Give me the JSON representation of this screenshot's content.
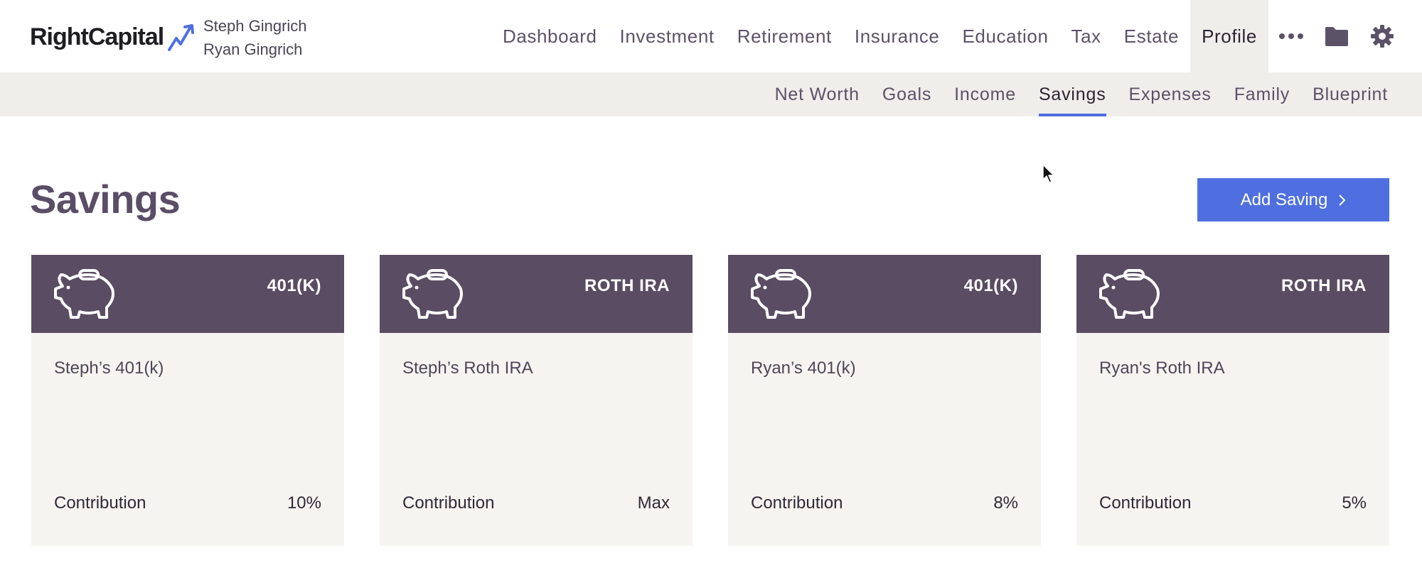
{
  "brand": {
    "name": "RightCapital",
    "accent": "#4f6fe0"
  },
  "clients": [
    "Steph Gingrich",
    "Ryan Gingrich"
  ],
  "main_nav": {
    "items": [
      "Dashboard",
      "Investment",
      "Retirement",
      "Insurance",
      "Education",
      "Tax",
      "Estate",
      "Profile"
    ],
    "active": "Profile",
    "icons": [
      "more-icon",
      "folder-icon",
      "gear-icon"
    ]
  },
  "sub_nav": {
    "items": [
      "Net Worth",
      "Goals",
      "Income",
      "Savings",
      "Expenses",
      "Family",
      "Blueprint"
    ],
    "active": "Savings"
  },
  "page": {
    "title": "Savings",
    "add_button_label": "Add Saving"
  },
  "cards": [
    {
      "type": "401(K)",
      "name": "Steph’s 401(k)",
      "contribution_label": "Contribution",
      "contribution_value": "10%"
    },
    {
      "type": "ROTH IRA",
      "name": "Steph’s Roth IRA",
      "contribution_label": "Contribution",
      "contribution_value": "Max"
    },
    {
      "type": "401(K)",
      "name": "Ryan’s 401(k)",
      "contribution_label": "Contribution",
      "contribution_value": "8%"
    },
    {
      "type": "ROTH IRA",
      "name": "Ryan's Roth IRA",
      "contribution_label": "Contribution",
      "contribution_value": "5%"
    }
  ],
  "colors": {
    "card_header": "#5a4c63",
    "card_body": "#f6f4f0",
    "subnav_bg": "#efeeeb",
    "primary_button": "#4f6fe0"
  }
}
